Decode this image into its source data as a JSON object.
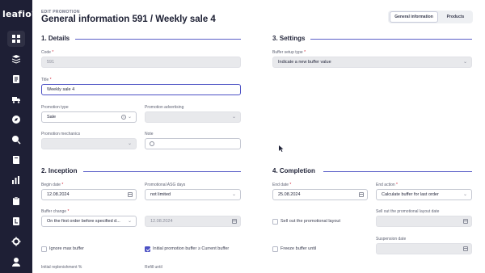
{
  "app": {
    "logo": "leafio",
    "logo_mark": "®"
  },
  "sidebar": {
    "items": [
      {
        "icon": "grid-icon"
      },
      {
        "icon": "stack-icon"
      },
      {
        "icon": "document-icon"
      },
      {
        "icon": "truck-icon"
      },
      {
        "icon": "compass-icon"
      },
      {
        "icon": "search-chart-icon"
      },
      {
        "icon": "book-icon"
      },
      {
        "icon": "bar-chart-icon"
      },
      {
        "icon": "clipboard-icon"
      },
      {
        "icon": "ledger-icon"
      },
      {
        "icon": "gear-icon"
      },
      {
        "icon": "user-icon"
      }
    ]
  },
  "header": {
    "eyebrow": "EDIT PROMOTION",
    "title": "General information 591 / Weekly sale 4",
    "tabs": [
      {
        "label": "General information",
        "active": true
      },
      {
        "label": "Products",
        "active": false
      }
    ]
  },
  "details": {
    "title": "1. Details",
    "code_label": "Code",
    "code_value": "591",
    "title_label": "Title",
    "title_value": "Weekly sale 4",
    "promo_type_label": "Promotion type",
    "promo_type_value": "Sale",
    "promo_adv_label": "Promotion advertising",
    "promo_adv_value": "",
    "promo_mech_label": "Promotion mechanics",
    "promo_mech_value": "",
    "note_label": "Note",
    "note_value": ""
  },
  "settings": {
    "title": "3. Settings",
    "buffer_setup_label": "Buffer setup type",
    "buffer_setup_value": "Indicate a new buffer value"
  },
  "inception": {
    "title": "2. Inception",
    "begin_date_label": "Begin date",
    "begin_date_value": "12.08.2024",
    "asg_days_label": "Promotional ASG days",
    "asg_days_value": "not limited",
    "buffer_change_label": "Buffer change",
    "buffer_change_value": "On the first order before specified d...",
    "buffer_change_date": "12.08.2024",
    "ignore_max_label": "Ignore max buffer",
    "ignore_max_checked": false,
    "initial_buffer_label": "Initial promotion buffer ≥ Current buffer",
    "initial_buffer_checked": true,
    "initial_replenishment_label": "Initial replenishment %",
    "refill_until_label": "Refill until"
  },
  "completion": {
    "title": "4. Completion",
    "end_date_label": "End date",
    "end_date_value": "25.08.2024",
    "end_action_label": "End action",
    "end_action_value": "Calculate buffer for last order",
    "sell_out_label": "Sell out the promotional layout",
    "sell_out_checked": false,
    "sell_out_date_label": "Sell out the promotional layout date",
    "sell_out_date_value": "",
    "freeze_label": "Freeze buffer until",
    "freeze_checked": false,
    "suspension_label": "Suspension date",
    "suspension_value": ""
  },
  "colors": {
    "sidebar": "#1e1f35",
    "accent": "#4c51c4",
    "required": "#d0283a"
  }
}
